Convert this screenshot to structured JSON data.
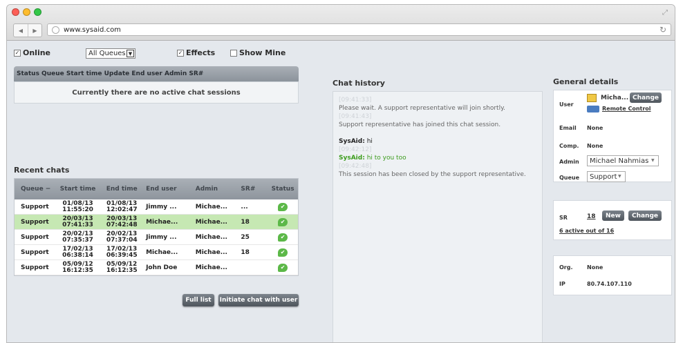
{
  "browser": {
    "url": "www.sysaid.com"
  },
  "toolbar": {
    "online_label": "Online",
    "online_checked": "✓",
    "queue_select": "All Queues",
    "effects_label": "Effects",
    "effects_checked": "✓",
    "show_mine_label": "Show Mine"
  },
  "sessions": {
    "header": "Status Queue Start time Update End user Admin     SR#",
    "empty_text": "Currently there are no active chat sessions"
  },
  "recent": {
    "title": "Recent chats",
    "columns": [
      "Queue −",
      "Start time",
      "End time",
      "End user",
      "Admin",
      "SR#",
      "Status"
    ],
    "rows": [
      {
        "queue": "Support",
        "start_date": "01/08/13",
        "start_time": "11:55:20",
        "end_date": "01/08/13",
        "end_time": "12:02:47",
        "user": "Jimmy ...",
        "admin": "Michae...",
        "sr": "...",
        "selected": false
      },
      {
        "queue": "Support",
        "start_date": "20/03/13",
        "start_time": "07:41:33",
        "end_date": "20/03/13",
        "end_time": "07:42:48",
        "user": "Michae...",
        "admin": "Michae...",
        "sr": "18",
        "selected": true
      },
      {
        "queue": "Support",
        "start_date": "20/02/13",
        "start_time": "07:35:37",
        "end_date": "20/02/13",
        "end_time": "07:37:04",
        "user": "Jimmy ...",
        "admin": "Michae...",
        "sr": "25",
        "selected": false
      },
      {
        "queue": "Support",
        "start_date": "17/02/13",
        "start_time": "06:38:14",
        "end_date": "17/02/13",
        "end_time": "06:39:45",
        "user": "Michae...",
        "admin": "Michae...",
        "sr": "18",
        "selected": false
      },
      {
        "queue": "Support",
        "start_date": "05/09/12",
        "start_time": "16:12:35",
        "end_date": "05/09/12",
        "end_time": "16:12:35",
        "user": "John Doe",
        "admin": "Michae...",
        "sr": "",
        "selected": false
      }
    ],
    "status_icon": "✔",
    "full_list_label": "Full list",
    "initiate_label": "Initiate chat with user"
  },
  "chat": {
    "title": "Chat history",
    "messages": [
      {
        "ts": "[09:41:33]",
        "text": "Please wait. A support representative will join shortly."
      },
      {
        "ts": "[09:41:43]",
        "text": "Support representative has joined this chat session."
      },
      {
        "name": "SysAid:",
        "text": "hi",
        "color": "#222222"
      },
      {
        "ts": "[09:42:12]",
        "name": "SysAid:",
        "text": "hi to you too",
        "color": "#3c9c1c"
      },
      {
        "ts": "[09:42:48]",
        "text": "This session has been closed by the support representative."
      }
    ]
  },
  "general": {
    "title": "General details",
    "user_label": "User",
    "user_value": "Micha...",
    "change_label": "Change",
    "remote_label": "Remote Control",
    "email_label": "Email",
    "email_value": "None",
    "comp_label": "Comp.",
    "comp_value": "None",
    "admin_label": "Admin",
    "admin_value": "Michael Nahmias",
    "queue_label": "Queue",
    "queue_value": "Support",
    "sr_label": "SR",
    "sr_value": "18",
    "new_label": "New",
    "sr_change_label": "Change",
    "active_text": "6 active out of 16",
    "org_label": "Org.",
    "org_value": "None",
    "ip_label": "IP",
    "ip_value": "80.74.107.110"
  }
}
